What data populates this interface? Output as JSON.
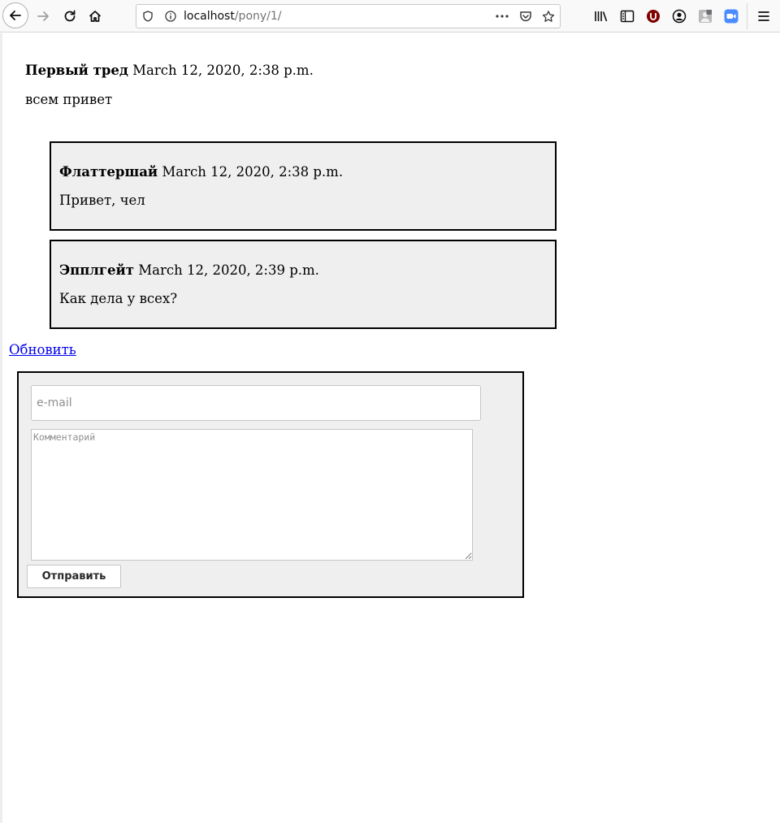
{
  "browser": {
    "url_host": "localhost",
    "url_path": "/pony/1/",
    "icons": [
      "back-arrow-icon",
      "forward-arrow-icon",
      "reload-icon",
      "home-icon",
      "shield-icon",
      "info-icon",
      "more-dots-icon",
      "pocket-icon",
      "star-icon",
      "library-icon",
      "sidebar-icon",
      "ublock-icon",
      "account-icon",
      "extension-icon",
      "zoom-icon",
      "menu-icon"
    ],
    "colors": {
      "ublock": "#800000",
      "zoom": "#4a8cff"
    }
  },
  "thread": {
    "title": "Первый тред",
    "date": "March 12, 2020, 2:38 p.m.",
    "body": "всем привет"
  },
  "comments": [
    {
      "author": "Флаттершай",
      "date": "March 12, 2020, 2:38 p.m.",
      "body": "Привет, чел"
    },
    {
      "author": "Эпплгейт",
      "date": "March 12, 2020, 2:39 p.m.",
      "body": "Как дела у всех?"
    }
  ],
  "refresh_label": "Обновить",
  "form": {
    "email_placeholder": "e-mail",
    "comment_placeholder": "Комментарий",
    "submit_label": "Отправить"
  }
}
